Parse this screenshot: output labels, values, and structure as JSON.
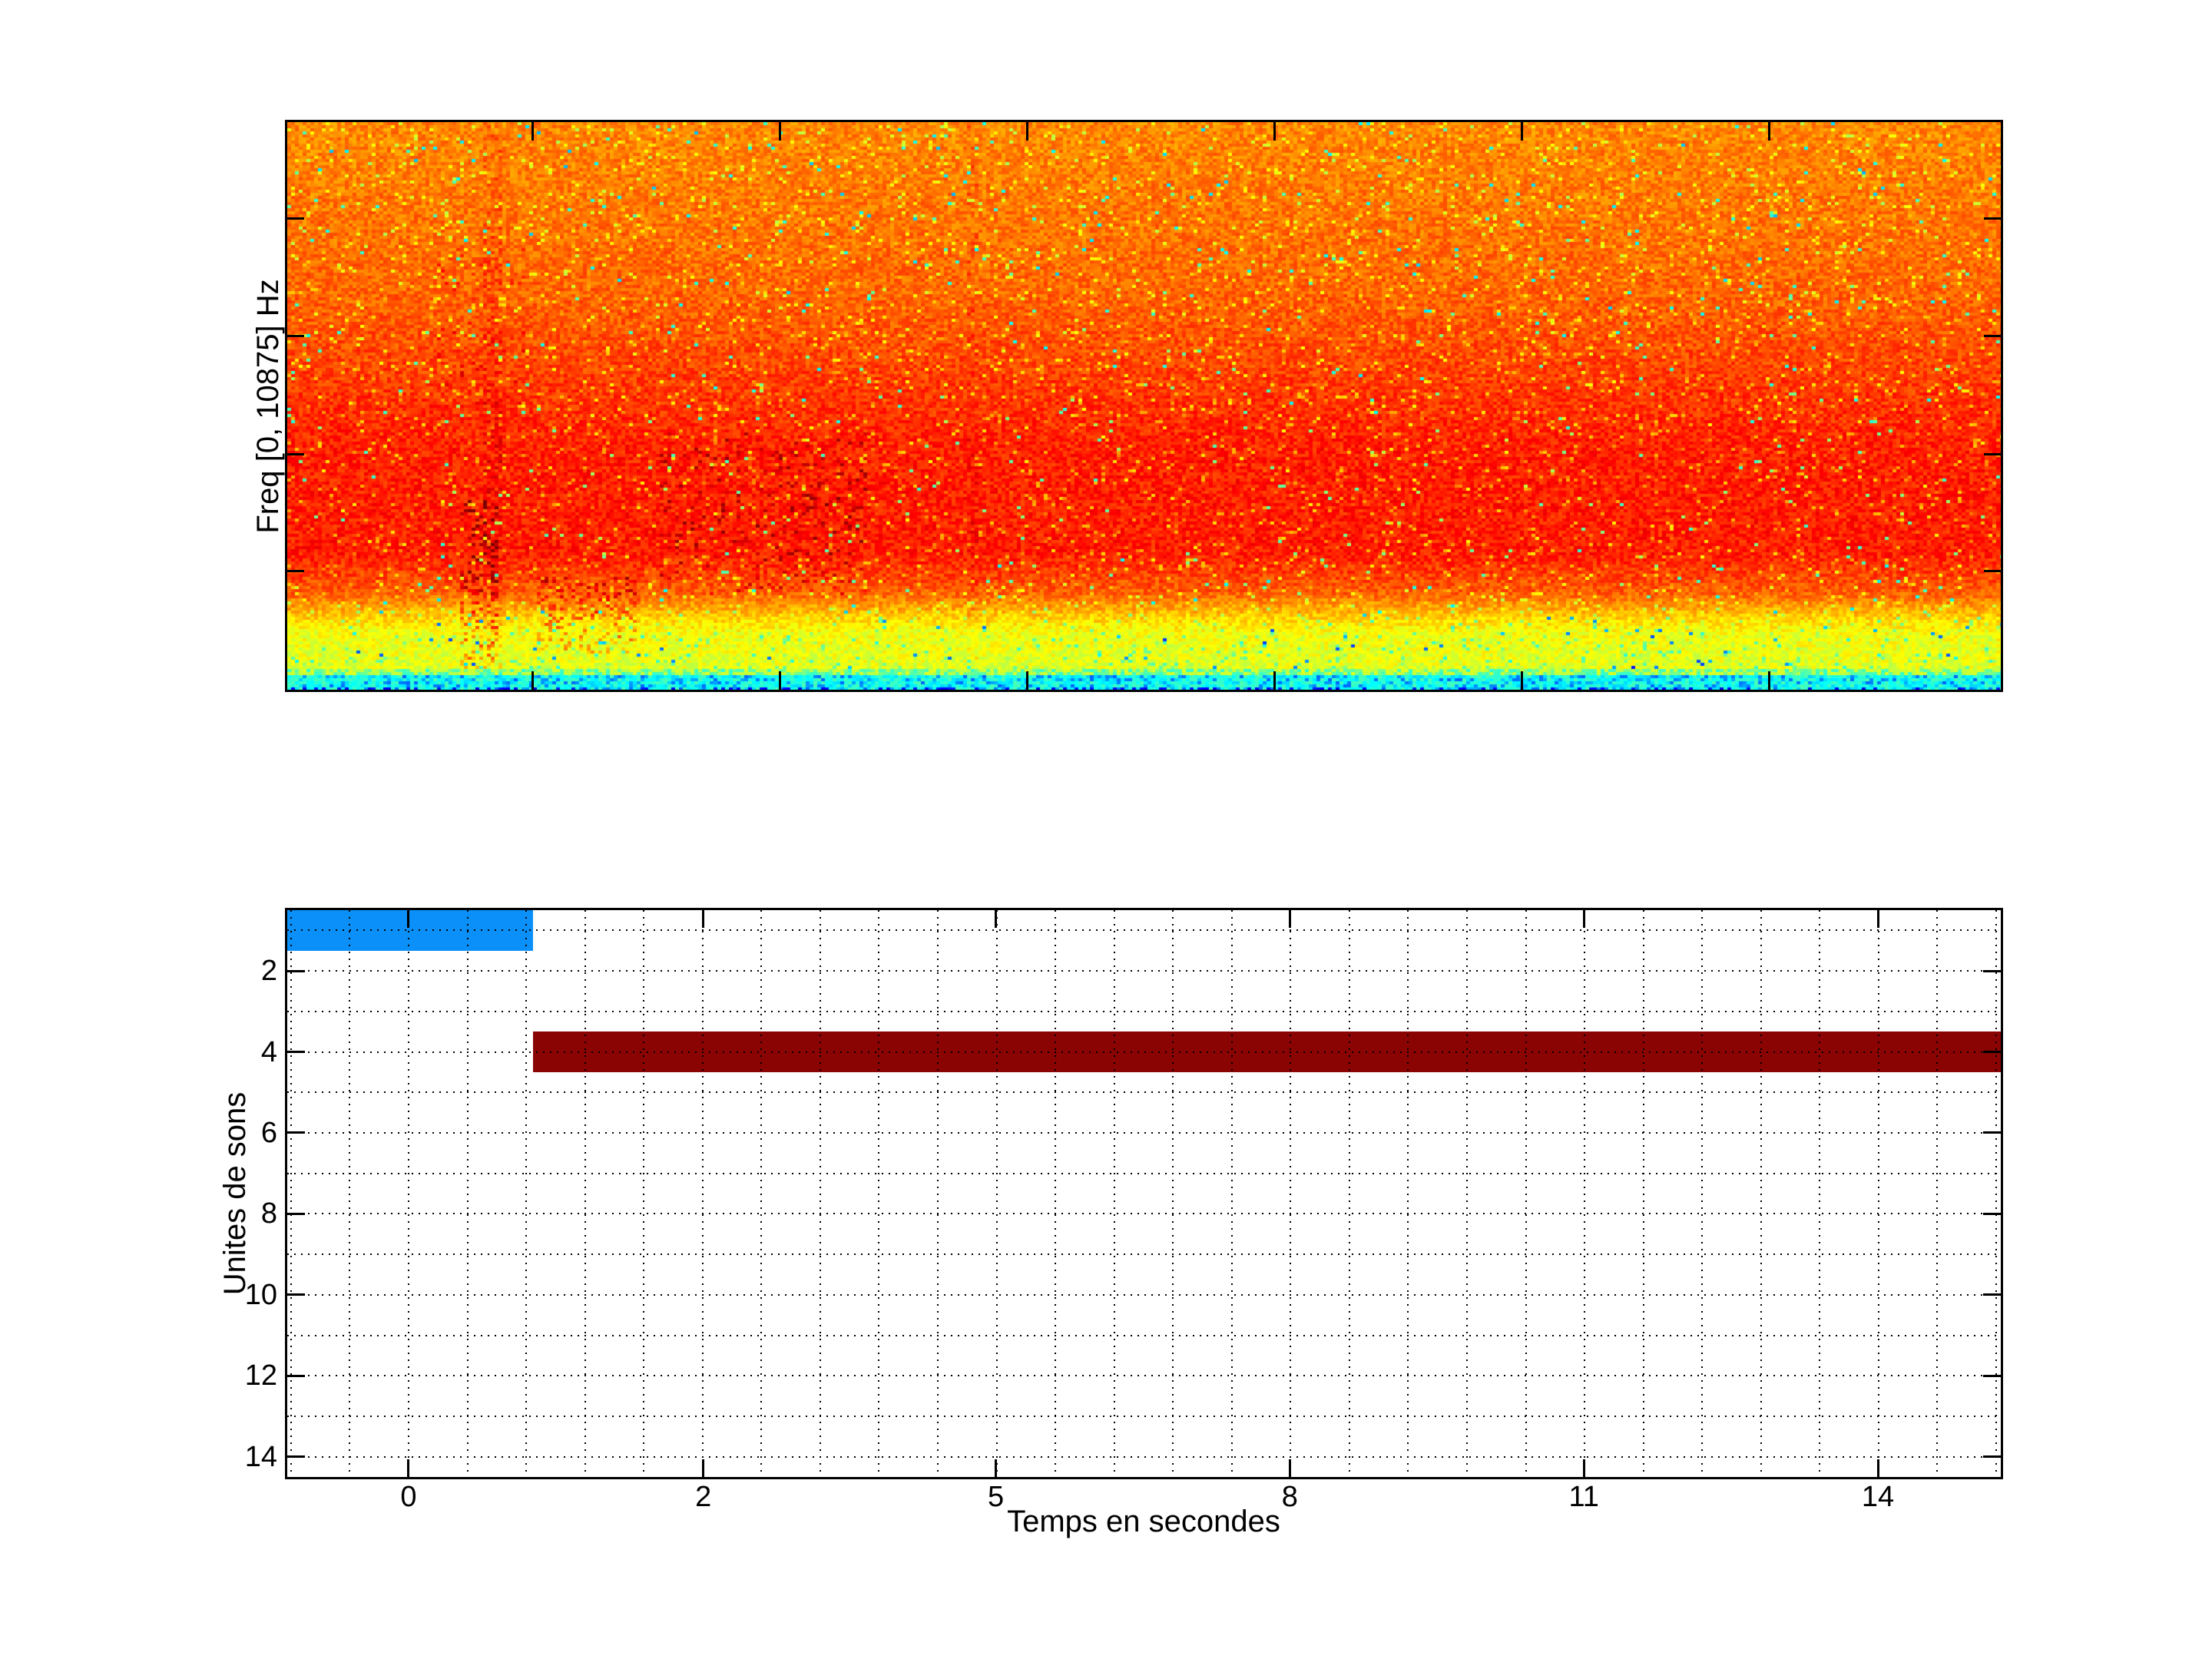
{
  "figure": {
    "background": "#ffffff"
  },
  "chart_data": [
    {
      "type": "heatmap",
      "name": "spectrogram",
      "title": "",
      "xlabel": "",
      "ylabel": "Freq [0, 10875] Hz",
      "colormap": "jet",
      "x_tick_labels": [],
      "y_tick_labels": [],
      "x_tick_fracs": [
        0.1434,
        0.2877,
        0.4319,
        0.5762,
        0.7204,
        0.8647
      ],
      "y_tick_fracs": [
        0.1705,
        0.3775,
        0.5846,
        0.7916
      ],
      "value_profile_points": [
        [
          0.0,
          0.742
        ],
        [
          0.1,
          0.752
        ],
        [
          0.3,
          0.775
        ],
        [
          0.48,
          0.822
        ],
        [
          0.58,
          0.845
        ],
        [
          0.76,
          0.848
        ],
        [
          0.83,
          0.78
        ],
        [
          0.872,
          0.67
        ],
        [
          0.9,
          0.615
        ],
        [
          0.962,
          0.598
        ],
        [
          0.97,
          0.565
        ],
        [
          0.976,
          0.4
        ],
        [
          1.0,
          0.365
        ]
      ],
      "cyan_strip_start_frac": 0.972,
      "noise_amp": 0.045,
      "speckle": {
        "p_yellow": 0.055,
        "p_green": 0.009
      },
      "dark_clusters": [
        {
          "x0": 224,
          "x1": 276,
          "y0": 491,
          "y1": 721,
          "p": 0.3,
          "dv": 0.085,
          "dvr": 0.07
        },
        {
          "x0": 326,
          "x1": 458,
          "y0": 593,
          "y1": 693,
          "p": 0.22,
          "dv": 0.08,
          "dvr": 0.05
        },
        {
          "x0": 486,
          "x1": 756,
          "y0": 406,
          "y1": 616,
          "p": 0.11,
          "dv": 0.055,
          "dvr": 0.05
        },
        {
          "x0": 186,
          "x1": 316,
          "y0": 156,
          "y1": 386,
          "p": 0.09,
          "dv": 0.04,
          "dvr": 0.03
        }
      ],
      "dark_streaks": [
        {
          "x": 267,
          "halfw": 12,
          "p": 0.5,
          "dv": 0.04
        },
        {
          "x": 894,
          "halfw": 8,
          "p": 0.35,
          "dv": 0.03
        }
      ],
      "band_colors_seen": {
        "top_body": "#ff6a00",
        "mid_body": "#ff2a00",
        "dark_spots": "#a00000",
        "yellow_band": "#ffd800",
        "cyan_strip": "#35e0c8",
        "blue_specks": "#0060ff"
      }
    },
    {
      "type": "bar",
      "name": "detected-sound-units",
      "orientation": "horizontal",
      "title": "",
      "xlabel": "Temps en secondes",
      "ylabel": "Unites de sons",
      "x_ticks": [
        {
          "label": "0",
          "frac": 0.0708
        },
        {
          "label": "2",
          "frac": 0.2428
        },
        {
          "label": "5",
          "frac": 0.4135
        },
        {
          "label": "8",
          "frac": 0.5851
        },
        {
          "label": "11",
          "frac": 0.7567
        },
        {
          "label": "14",
          "frac": 0.9283
        }
      ],
      "y_ticks": [
        {
          "label": "2",
          "value": 2
        },
        {
          "label": "4",
          "value": 4
        },
        {
          "label": "6",
          "value": 6
        },
        {
          "label": "8",
          "value": 8
        },
        {
          "label": "10",
          "value": 10
        },
        {
          "label": "12",
          "value": 12
        },
        {
          "label": "14",
          "value": 14
        }
      ],
      "ylim": [
        0.5,
        14.5
      ],
      "y_axis_reversed": true,
      "grid": {
        "style": "dotted",
        "v_start_frac": 0.00217,
        "v_step_frac": 0.034315,
        "v_count": 30,
        "h_values": [
          1,
          2,
          3,
          4,
          5,
          6,
          7,
          8,
          9,
          10,
          11,
          12,
          13,
          14
        ]
      },
      "bars": [
        {
          "name": "sound-unit-1",
          "row_center": 1,
          "row_span": [
            0.5,
            1.5
          ],
          "x_start_frac": 0.0,
          "x_end_frac": 0.1434,
          "color": "#0a90f8",
          "note": "starts at left axis edge, ends between tick 0 and tick 2"
        },
        {
          "name": "sound-unit-4",
          "row_center": 4,
          "row_span": [
            3.5,
            4.5
          ],
          "x_start_frac": 0.1434,
          "x_end_frac": 1.0,
          "color": "#8a0404",
          "note": "starts where blue bar ends, extends to right axis edge"
        }
      ]
    }
  ]
}
